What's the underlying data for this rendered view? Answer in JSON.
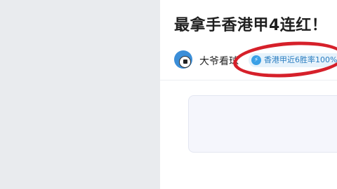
{
  "article": {
    "title": "最拿手香港甲4连红！",
    "author": {
      "name": "大爷看球"
    },
    "badge": {
      "label": "香港甲近6胜率100%"
    }
  },
  "colors": {
    "annotation": "#d6202a",
    "badge_text": "#2a7dc0",
    "badge_bg": "#e6f2fb"
  },
  "icons": {
    "avatar": "soccer-ball-icon",
    "badge": "lightning-icon"
  }
}
